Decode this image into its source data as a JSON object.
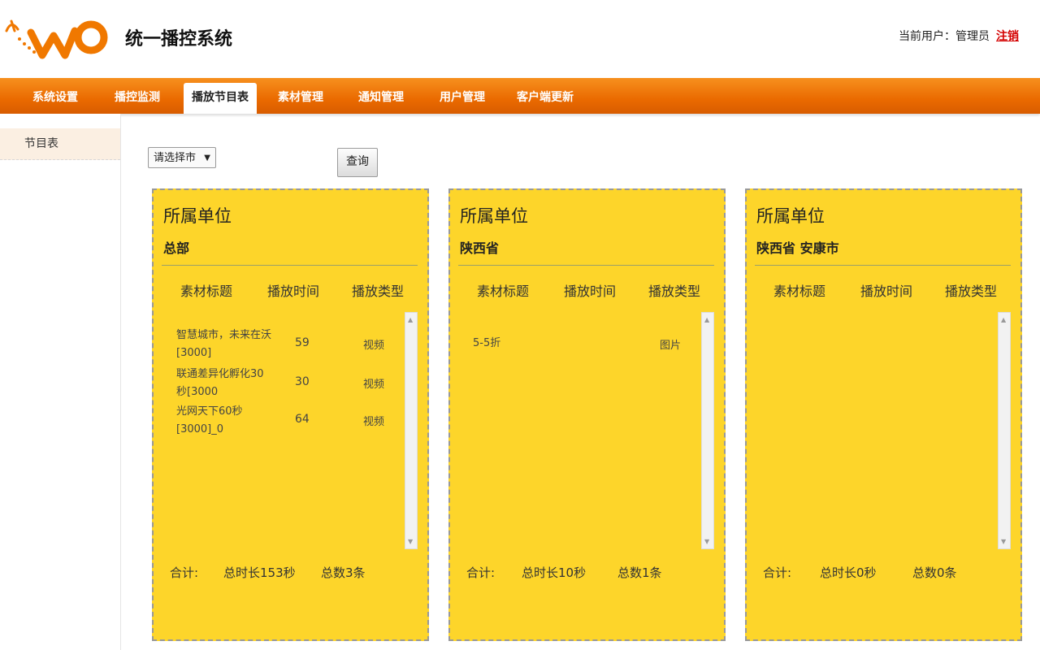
{
  "header": {
    "title": "统一播控系统",
    "user_label": "当前用户：管理员",
    "logout": "注销"
  },
  "nav": {
    "items": [
      {
        "label": "系统设置"
      },
      {
        "label": "播控监测"
      },
      {
        "label": "播放节目表"
      },
      {
        "label": "素材管理"
      },
      {
        "label": "通知管理"
      },
      {
        "label": "用户管理"
      },
      {
        "label": "客户端更新"
      }
    ],
    "active_index": 2
  },
  "sidebar": {
    "items": [
      {
        "label": "节目表"
      }
    ]
  },
  "filter": {
    "city_select": "请选择市",
    "query_button": "查询"
  },
  "cards": [
    {
      "title": "所属单位",
      "unit": "总部",
      "columns": [
        "素材标题",
        "播放时间",
        "播放类型"
      ],
      "rows": [
        {
          "title": "智慧城市，未来在沃[3000]",
          "time": "59",
          "type": "视频"
        },
        {
          "title": "联通差异化孵化30秒[3000",
          "time": "30",
          "type": "视频"
        },
        {
          "title": "光网天下60秒[3000]_0",
          "time": "64",
          "type": "视频"
        }
      ],
      "total_label": "合计:",
      "total_duration": "总时长153秒",
      "total_count": "总数3条"
    },
    {
      "title": "所属单位",
      "unit": "陕西省",
      "columns": [
        "素材标题",
        "播放时间",
        "播放类型"
      ],
      "rows": [
        {
          "title": "5-5折",
          "time": "",
          "type": "图片"
        }
      ],
      "total_label": "合计:",
      "total_duration": "总时长10秒",
      "total_count": "总数1条"
    },
    {
      "title": "所属单位",
      "unit": "陕西省 安康市",
      "columns": [
        "素材标题",
        "播放时间",
        "播放类型"
      ],
      "rows": [],
      "total_label": "合计:",
      "total_duration": "总时长0秒",
      "total_count": "总数0条"
    }
  ],
  "colors": {
    "nav_orange": "#ea6a00",
    "card_yellow": "#fdd52a",
    "logout_red": "#d40000"
  }
}
